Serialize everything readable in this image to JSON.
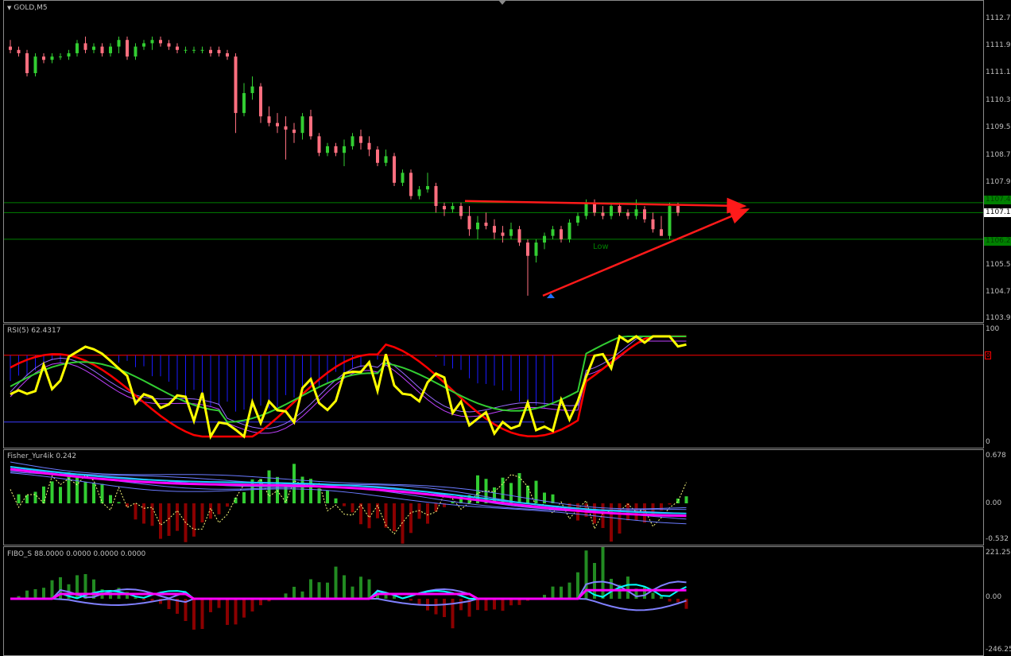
{
  "main": {
    "title": "GOLD,M5",
    "low_label": "Low",
    "price_scale": [
      "1112.75",
      "1111.95",
      "1111.15",
      "1110.35",
      "1109.55",
      "1108.75",
      "1107.95",
      "1105.55",
      "1104.75",
      "1103.95"
    ],
    "price_boxes": {
      "upper": "1107.4",
      "current": "1107.10",
      "lower": "1106.2"
    },
    "colors": {
      "bull": "#32cd32",
      "bear": "#ff6f7f",
      "trend": "#ff1a1a",
      "level": "#008000"
    }
  },
  "rsi": {
    "title": "RSI(5) 62.4317",
    "scale": [
      "100",
      "0"
    ],
    "level_marker": "0",
    "colors": {
      "fast": "#ffff00",
      "mid": "#32cd32",
      "slow": "#ff0000",
      "hist": "#1a1aff"
    }
  },
  "fisher": {
    "title": "Fisher_Yur4ik 0.242",
    "scale": [
      "0.678",
      "0.00",
      "-0.532"
    ],
    "colors": {
      "up": "#32cd32",
      "down": "#8b0000",
      "line": "#ff00ff",
      "signal": "#ffff80"
    }
  },
  "fibo": {
    "title": "FIBO_S 88.0000 0.0000 0.0000 0.0000",
    "scale": [
      "221.25",
      "0.00",
      "-246.25"
    ],
    "colors": {
      "up": "#228b22",
      "down": "#8b0000",
      "cyan": "#00ffff",
      "violet": "#8080ff",
      "magenta": "#ff00ff"
    }
  },
  "chart_data": {
    "type": "candlestick",
    "symbol": "GOLD",
    "timeframe": "M5",
    "ylim": [
      1103.95,
      1113.0
    ],
    "candles": [
      [
        1112.1,
        1112.3,
        1111.9,
        1112.0
      ],
      [
        1112.0,
        1112.1,
        1111.8,
        1111.9
      ],
      [
        1111.9,
        1112.0,
        1111.2,
        1111.3
      ],
      [
        1111.3,
        1111.9,
        1111.2,
        1111.8
      ],
      [
        1111.8,
        1111.9,
        1111.6,
        1111.7
      ],
      [
        1111.7,
        1111.9,
        1111.6,
        1111.8
      ],
      [
        1111.8,
        1111.9,
        1111.7,
        1111.8
      ],
      [
        1111.8,
        1112.0,
        1111.7,
        1111.9
      ],
      [
        1111.9,
        1112.3,
        1111.8,
        1112.2
      ],
      [
        1112.2,
        1112.4,
        1111.9,
        1112.0
      ],
      [
        1112.0,
        1112.2,
        1111.9,
        1112.1
      ],
      [
        1112.1,
        1112.2,
        1111.8,
        1111.9
      ],
      [
        1111.9,
        1112.2,
        1111.8,
        1112.1
      ],
      [
        1112.1,
        1112.4,
        1111.9,
        1112.3
      ],
      [
        1112.3,
        1112.4,
        1111.7,
        1111.8
      ],
      [
        1111.8,
        1112.2,
        1111.7,
        1112.1
      ],
      [
        1112.1,
        1112.3,
        1112.0,
        1112.2
      ],
      [
        1112.2,
        1112.4,
        1112.0,
        1112.3
      ],
      [
        1112.3,
        1112.4,
        1112.1,
        1112.2
      ],
      [
        1112.2,
        1112.3,
        1112.0,
        1112.1
      ],
      [
        1112.1,
        1112.2,
        1111.9,
        1112.0
      ],
      [
        1112.0,
        1112.1,
        1111.9,
        1112.0
      ],
      [
        1112.0,
        1112.1,
        1111.9,
        1112.0
      ],
      [
        1112.0,
        1112.1,
        1111.9,
        1112.0
      ],
      [
        1112.0,
        1112.1,
        1111.8,
        1111.9
      ],
      [
        1112.0,
        1112.1,
        1111.8,
        1111.9
      ],
      [
        1111.9,
        1112.0,
        1111.7,
        1111.8
      ],
      [
        1111.8,
        1111.9,
        1109.5,
        1110.1
      ],
      [
        1110.1,
        1111.0,
        1110.0,
        1110.7
      ],
      [
        1110.7,
        1111.2,
        1110.5,
        1110.9
      ],
      [
        1110.9,
        1111.0,
        1109.8,
        1110.0
      ],
      [
        1110.0,
        1110.3,
        1109.7,
        1109.8
      ],
      [
        1109.8,
        1110.1,
        1109.5,
        1109.7
      ],
      [
        1109.7,
        1110.0,
        1108.7,
        1109.6
      ],
      [
        1109.6,
        1109.8,
        1109.2,
        1109.5
      ],
      [
        1109.5,
        1110.1,
        1109.3,
        1110.0
      ],
      [
        1110.0,
        1110.2,
        1109.3,
        1109.4
      ],
      [
        1109.4,
        1109.5,
        1108.8,
        1108.9
      ],
      [
        1108.9,
        1109.2,
        1108.8,
        1109.1
      ],
      [
        1109.1,
        1109.2,
        1108.8,
        1108.9
      ],
      [
        1108.9,
        1109.3,
        1108.5,
        1109.1
      ],
      [
        1109.1,
        1109.5,
        1109.0,
        1109.4
      ],
      [
        1109.4,
        1109.6,
        1109.0,
        1109.2
      ],
      [
        1109.2,
        1109.4,
        1108.8,
        1109.0
      ],
      [
        1109.0,
        1109.1,
        1108.5,
        1108.6
      ],
      [
        1108.6,
        1109.0,
        1108.5,
        1108.8
      ],
      [
        1108.8,
        1108.9,
        1107.9,
        1108.0
      ],
      [
        1108.0,
        1108.4,
        1107.9,
        1108.3
      ],
      [
        1108.3,
        1108.4,
        1107.5,
        1107.6
      ],
      [
        1107.6,
        1107.9,
        1107.5,
        1107.8
      ],
      [
        1107.8,
        1108.3,
        1107.7,
        1107.9
      ],
      [
        1107.9,
        1108.0,
        1107.1,
        1107.3
      ],
      [
        1107.3,
        1107.4,
        1107.0,
        1107.2
      ],
      [
        1107.2,
        1107.4,
        1107.1,
        1107.3
      ],
      [
        1107.3,
        1107.4,
        1106.9,
        1107.0
      ],
      [
        1107.0,
        1107.3,
        1106.4,
        1106.6
      ],
      [
        1106.6,
        1107.0,
        1106.3,
        1106.8
      ],
      [
        1106.8,
        1107.1,
        1106.6,
        1106.7
      ],
      [
        1106.7,
        1106.9,
        1106.3,
        1106.5
      ],
      [
        1106.5,
        1106.7,
        1106.2,
        1106.4
      ],
      [
        1106.4,
        1106.8,
        1106.3,
        1106.6
      ],
      [
        1106.6,
        1106.7,
        1106.1,
        1106.2
      ],
      [
        1106.2,
        1106.3,
        1104.6,
        1105.8
      ],
      [
        1105.8,
        1106.3,
        1105.6,
        1106.2
      ],
      [
        1106.2,
        1106.5,
        1106.0,
        1106.4
      ],
      [
        1106.4,
        1106.7,
        1106.3,
        1106.6
      ],
      [
        1106.6,
        1106.7,
        1106.2,
        1106.3
      ],
      [
        1106.3,
        1106.9,
        1106.2,
        1106.8
      ],
      [
        1106.8,
        1107.1,
        1106.7,
        1107.0
      ],
      [
        1107.0,
        1107.5,
        1106.9,
        1107.4
      ],
      [
        1107.4,
        1107.5,
        1107.0,
        1107.1
      ],
      [
        1107.1,
        1107.3,
        1106.9,
        1107.0
      ],
      [
        1107.0,
        1107.4,
        1106.9,
        1107.3
      ],
      [
        1107.3,
        1107.4,
        1107.0,
        1107.1
      ],
      [
        1107.1,
        1107.2,
        1106.9,
        1107.0
      ],
      [
        1107.0,
        1107.5,
        1106.9,
        1107.2
      ],
      [
        1107.2,
        1107.3,
        1106.8,
        1106.9
      ],
      [
        1106.9,
        1107.1,
        1106.5,
        1106.6
      ],
      [
        1106.6,
        1107.0,
        1106.5,
        1106.4
      ],
      [
        1106.4,
        1107.4,
        1106.3,
        1107.3
      ],
      [
        1107.3,
        1107.4,
        1107.0,
        1107.1
      ]
    ],
    "horizontal_levels": [
      1107.4,
      1107.1,
      1106.3
    ]
  }
}
